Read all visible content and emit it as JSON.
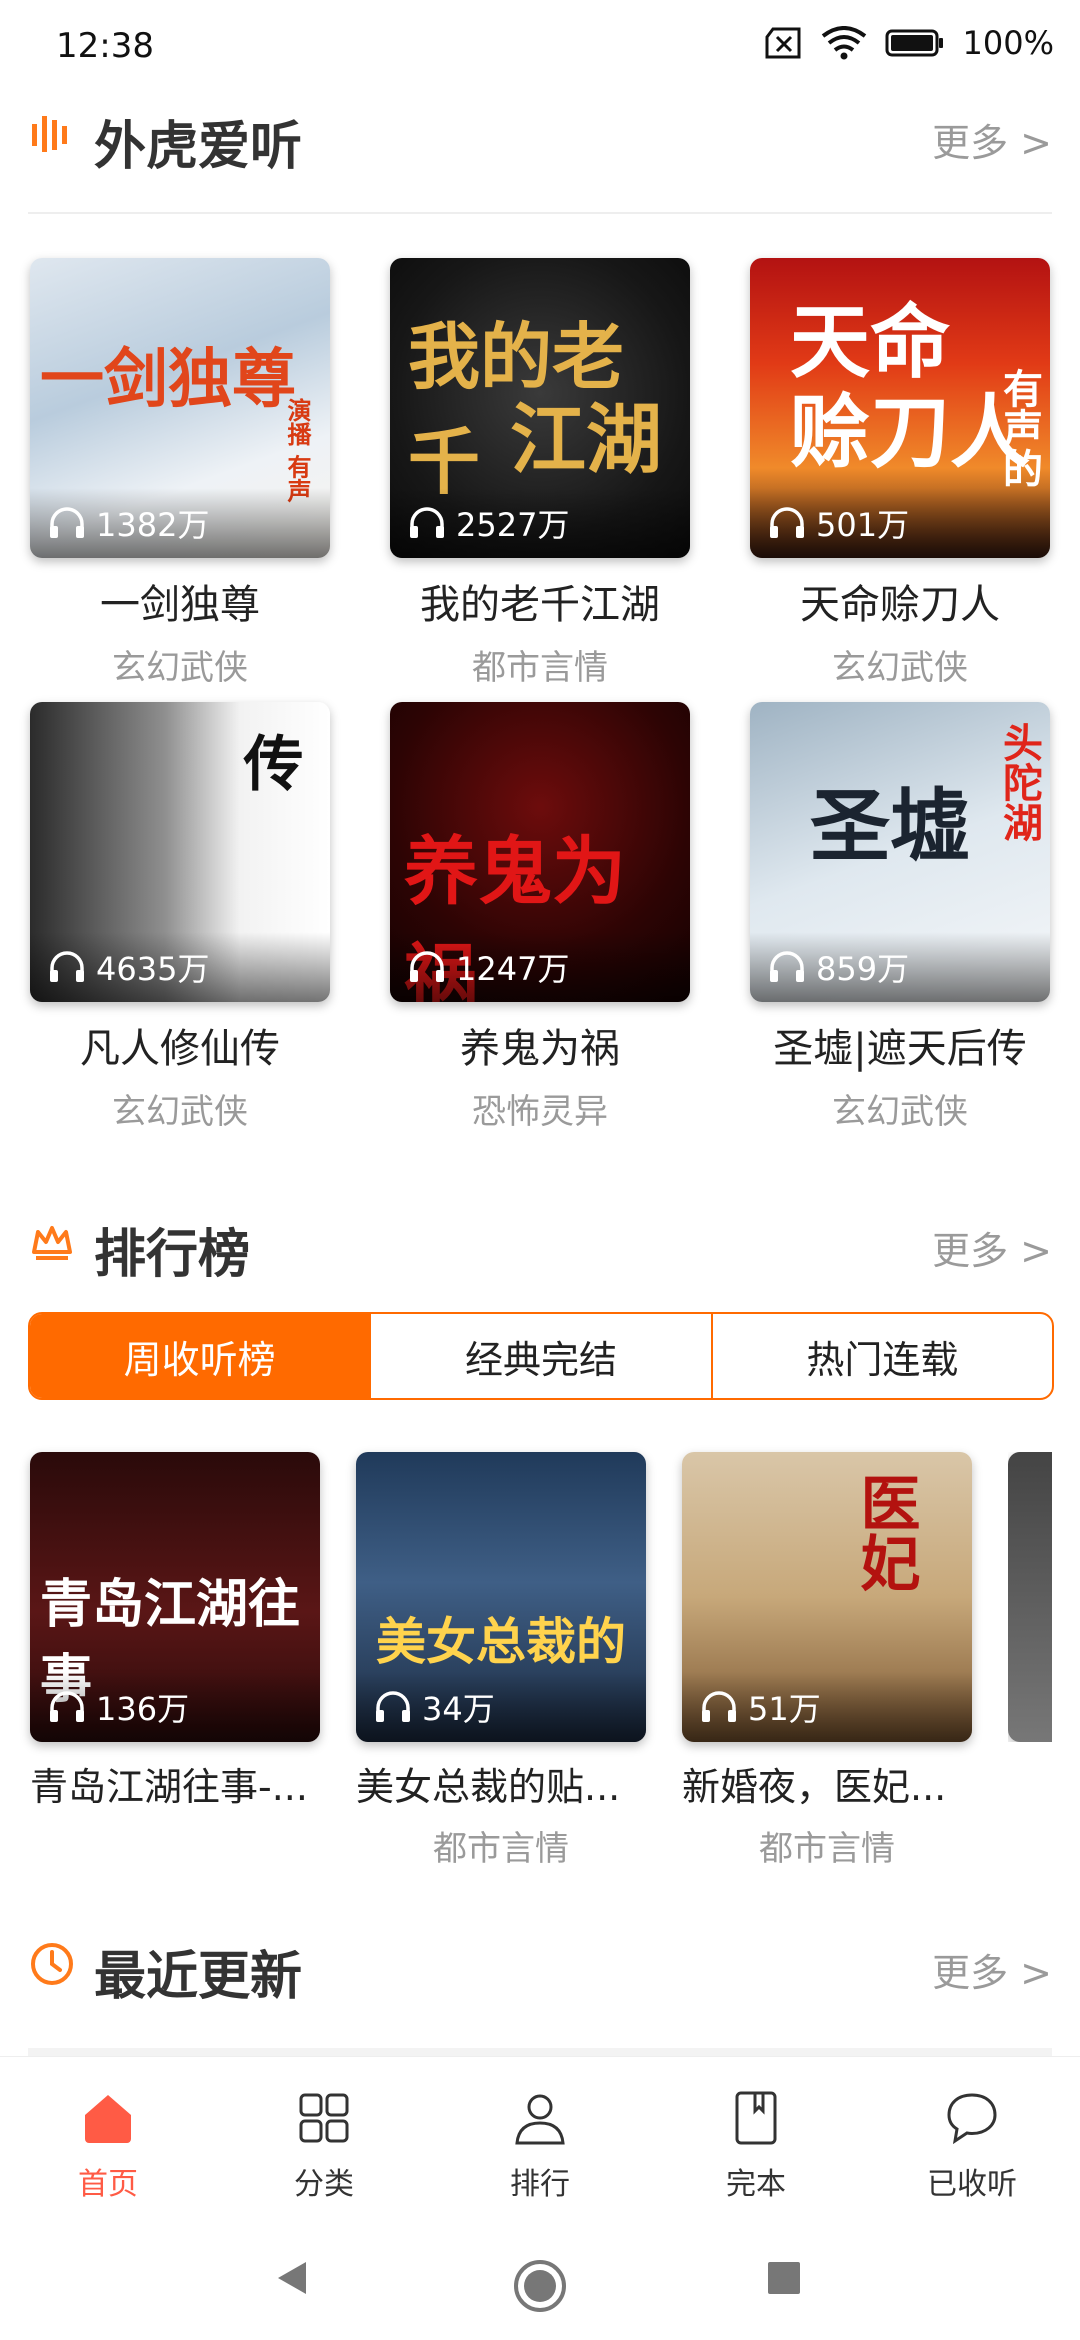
{
  "status": {
    "time": "12:38",
    "battery": "100%"
  },
  "sections": {
    "listen": {
      "title": "外虎爱听",
      "more": "更多 >"
    },
    "ranking": {
      "title": "排行榜",
      "more": "更多 >"
    },
    "recent": {
      "title": "最近更新",
      "more": "更多 >"
    }
  },
  "grid": [
    {
      "name": "一剑独尊",
      "genre": "玄幻武侠",
      "count": "1382万"
    },
    {
      "name": "我的老千江湖",
      "genre": "都市言情",
      "count": "2527万"
    },
    {
      "name": "天命赊刀人",
      "genre": "玄幻武侠",
      "count": "501万"
    },
    {
      "name": "凡人修仙传",
      "genre": "玄幻武侠",
      "count": "4635万"
    },
    {
      "name": "养鬼为祸",
      "genre": "恐怖灵异",
      "count": "1247万"
    },
    {
      "name": "圣墟|遮天后传",
      "genre": "玄幻武侠",
      "count": "859万"
    }
  ],
  "tabs": [
    "周收听榜",
    "经典完结",
    "热门连载"
  ],
  "ranking": [
    {
      "name": "青岛江湖往事-...",
      "genre": "",
      "count": "136万"
    },
    {
      "name": "美女总裁的贴...",
      "genre": "都市言情",
      "count": "34万"
    },
    {
      "name": "新婚夜，医妃...",
      "genre": "都市言情",
      "count": "51万"
    }
  ],
  "nav": [
    {
      "label": "首页"
    },
    {
      "label": "分类"
    },
    {
      "label": "排行"
    },
    {
      "label": "完本"
    },
    {
      "label": "已收听"
    }
  ],
  "colors": {
    "accent": "#ff6a00",
    "active_nav": "#ff5b45"
  }
}
